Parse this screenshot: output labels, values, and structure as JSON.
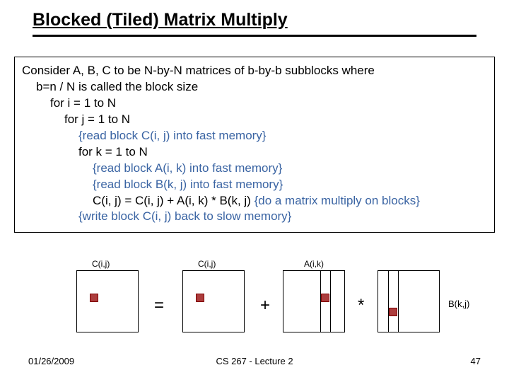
{
  "title": "Blocked (Tiled) Matrix Multiply",
  "algo": {
    "l0": "Consider A, B, C to be N-by-N matrices of b-by-b subblocks where",
    "l1": "b=n / N is called the block size",
    "l2": "for i = 1 to N",
    "l3": "for j = 1 to N",
    "l4a": "{read block C(i, j) into fast memory}",
    "l4b": "for k = 1 to N",
    "l5a": "{read block A(i, k) into fast memory}",
    "l5b": "{read block B(k, j) into fast memory}",
    "l5c_pre": "C(i, j) = C(i, j) + A(i, k) * B(k, j) ",
    "l5c_cmt": "{do a matrix multiply on blocks}",
    "l4c": "{write block C(i, j) back to slow memory}"
  },
  "diagram": {
    "c1_label": "C(i,j)",
    "c2_label": "C(i,j)",
    "a_label": "A(i,k)",
    "b_label": "B(k,j)",
    "eq": "=",
    "plus": "+",
    "star": "*"
  },
  "footer": {
    "date": "01/26/2009",
    "center": "CS 267 - Lecture 2",
    "page": "47"
  }
}
